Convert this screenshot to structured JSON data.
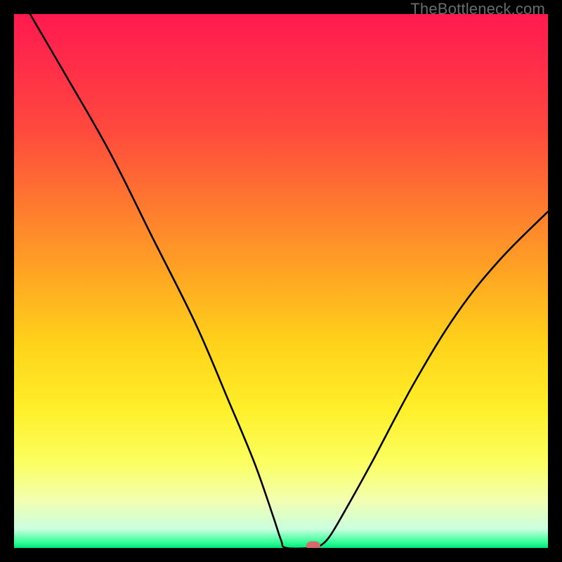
{
  "watermark": "TheBottleneck.com",
  "chart_data": {
    "type": "line",
    "title": "",
    "xlabel": "",
    "ylabel": "",
    "xlim": [
      0,
      100
    ],
    "ylim": [
      0,
      100
    ],
    "grid": false,
    "series": [
      {
        "name": "curve",
        "x": [
          3,
          10,
          18,
          26,
          34,
          40,
          45,
          48.5,
          50,
          51,
          56,
          57,
          59,
          62,
          67,
          75,
          83,
          91,
          100
        ],
        "y": [
          100,
          88,
          74,
          58,
          42,
          28,
          16,
          6,
          1.5,
          0,
          0,
          0.2,
          2,
          7,
          16,
          31,
          44,
          54,
          63
        ]
      }
    ],
    "marker": {
      "x": 56,
      "y": 0,
      "color": "#d46a6a"
    },
    "background": "rainbow-vertical-gradient"
  }
}
